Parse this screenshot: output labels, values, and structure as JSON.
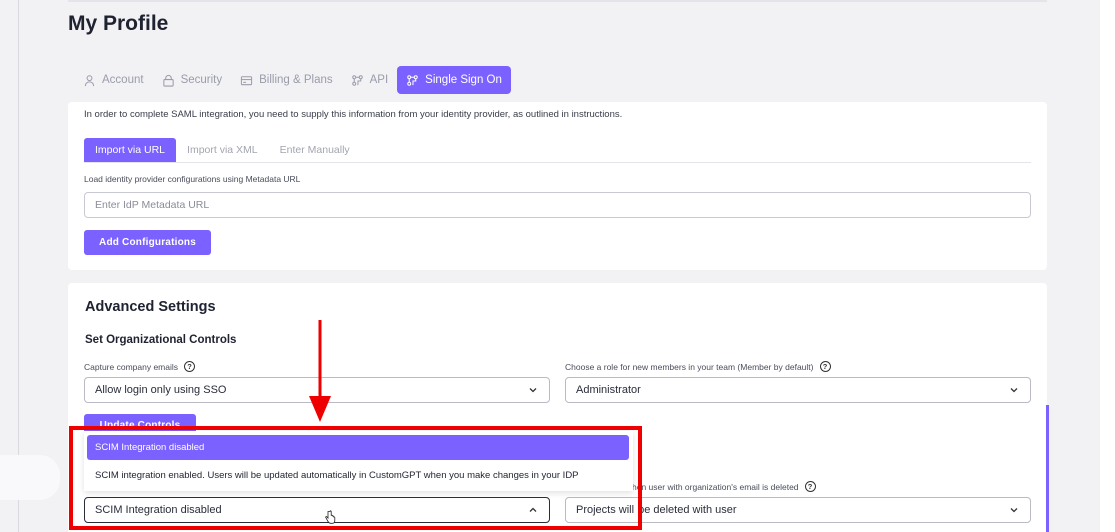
{
  "page": {
    "title": "My Profile"
  },
  "tabs": [
    {
      "label": "Account",
      "icon": "user-icon"
    },
    {
      "label": "Security",
      "icon": "lock-icon"
    },
    {
      "label": "Billing & Plans",
      "icon": "credit-card-icon"
    },
    {
      "label": "API",
      "icon": "api-icon"
    },
    {
      "label": "Single Sign On",
      "icon": "sso-icon",
      "active": true
    }
  ],
  "saml": {
    "intro": "In order to complete SAML integration, you need to supply this information from your identity provider, as outlined in instructions.",
    "subtabs": [
      "Import via URL",
      "Import via XML",
      "Enter Manually"
    ],
    "metadata_label": "Load identity provider configurations using Metadata URL",
    "metadata_placeholder": "Enter IdP Metadata URL",
    "add_button": "Add Configurations"
  },
  "advanced": {
    "title": "Advanced Settings",
    "org_controls_title": "Set Organizational Controls",
    "capture_label": "Capture company emails",
    "capture_value": "Allow login only using SSO",
    "role_label": "Choose a role for new members in your team (Member by default)",
    "role_value": "Administrator",
    "update_button": "Update Controls",
    "deleted_label": "hen user with organization's email is deleted",
    "deleted_value_left": "Projects will",
    "deleted_value_right": "be deleted with user",
    "scim_value": "SCIM Integration disabled",
    "scim_options": [
      "SCIM Integration disabled",
      "SCIM integration enabled. Users will be updated automatically in CustomGPT when you make changes in your IDP"
    ]
  },
  "colors": {
    "accent": "#7b61ff",
    "highlight": "#ee0000"
  }
}
